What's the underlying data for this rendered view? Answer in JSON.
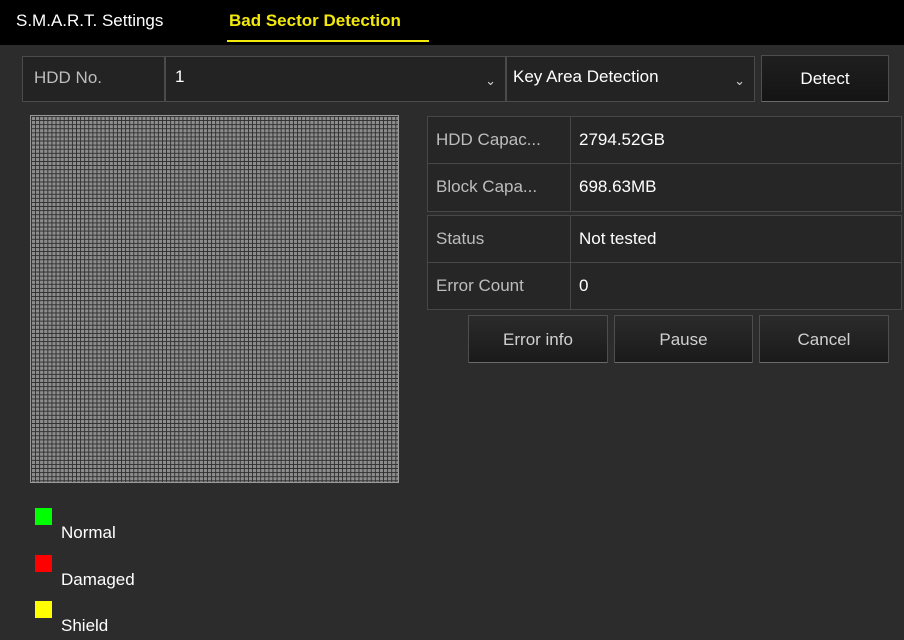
{
  "tabs": [
    {
      "label": "S.M.A.R.T. Settings",
      "active": false
    },
    {
      "label": "Bad Sector Detection",
      "active": true
    }
  ],
  "hdd": {
    "label": "HDD No.",
    "value": "1"
  },
  "mode": {
    "value": "Key Area Detection"
  },
  "detect_label": "Detect",
  "info": {
    "capacity_label": "HDD Capac...",
    "capacity_value": "2794.52GB",
    "block_label": "Block Capa...",
    "block_value": "698.63MB",
    "status_label": "Status",
    "status_value": "Not tested",
    "error_label": "Error Count",
    "error_value": "0"
  },
  "actions": {
    "error_info": "Error info",
    "pause": "Pause",
    "cancel": "Cancel"
  },
  "legend": [
    {
      "label": "Normal",
      "color": "#00ff00"
    },
    {
      "label": "Damaged",
      "color": "#ff0000"
    },
    {
      "label": "Shield",
      "color": "#ffff00"
    }
  ],
  "icons": {
    "dropdown": "chevron-down-icon"
  },
  "colors": {
    "accent": "#f2e80a",
    "panel": "#2c2c2c",
    "grid": "#8d8d8d"
  }
}
